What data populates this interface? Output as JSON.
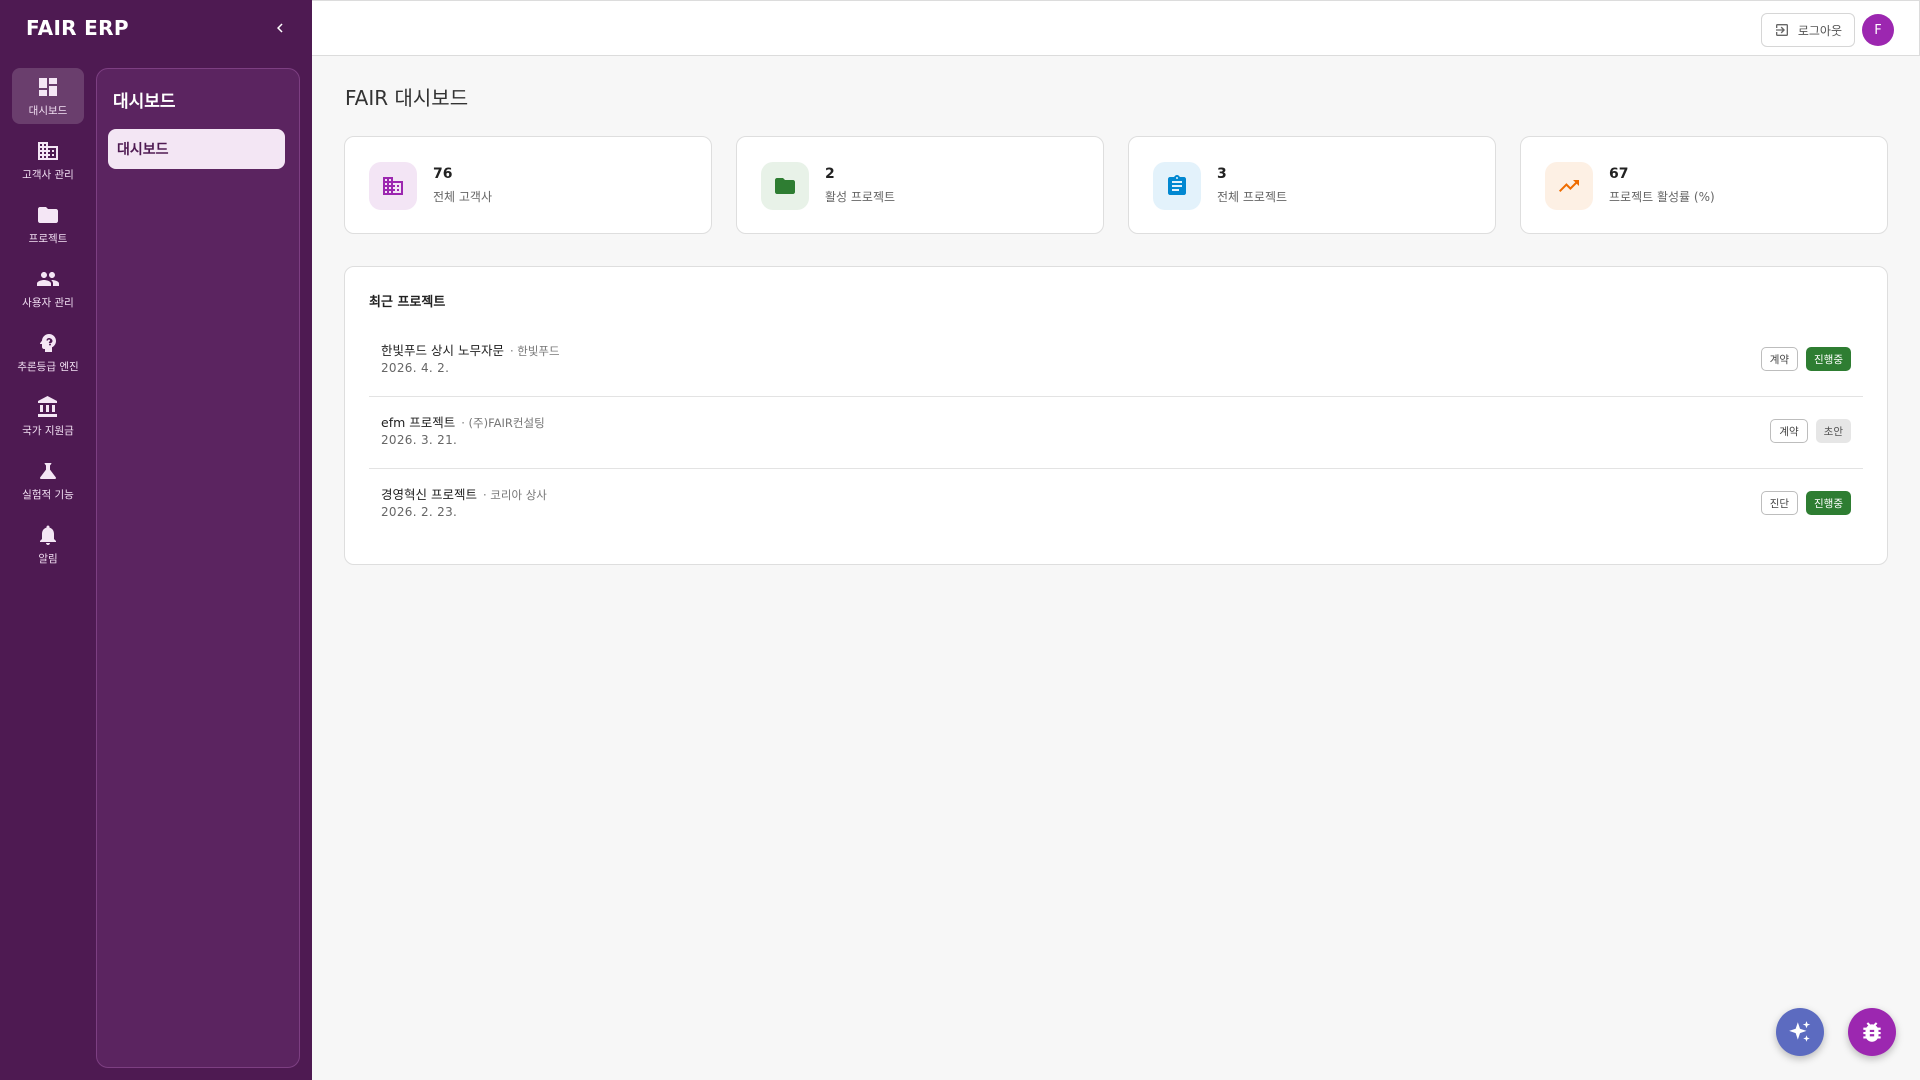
{
  "app": {
    "brand": "FAIR ERP"
  },
  "sidebar": {
    "items": [
      {
        "label": "대시보드",
        "icon": "dashboard-icon",
        "active": true
      },
      {
        "label": "고객사 관리",
        "icon": "building-icon"
      },
      {
        "label": "프로젝트",
        "icon": "folder-icon"
      },
      {
        "label": "사용자 관리",
        "icon": "people-icon"
      },
      {
        "label": "추론등급 엔진",
        "icon": "psychology-icon"
      },
      {
        "label": "국가 지원금",
        "icon": "bank-icon"
      },
      {
        "label": "실험적 기능",
        "icon": "flask-icon"
      },
      {
        "label": "알림",
        "icon": "bell-icon"
      }
    ],
    "subpanel": {
      "title": "대시보드",
      "items": [
        {
          "label": "대시보드"
        }
      ]
    }
  },
  "header": {
    "logout_label": "로그아웃",
    "avatar_initial": "F"
  },
  "main": {
    "title": "FAIR 대시보드",
    "stats": [
      {
        "value": "76",
        "label": "전체 고객사",
        "icon": "building-icon",
        "color": "#9c27b0",
        "bg": "#f3e5f5"
      },
      {
        "value": "2",
        "label": "활성 프로젝트",
        "icon": "folder-icon",
        "color": "#2e7d32",
        "bg": "#e8f2e8"
      },
      {
        "value": "3",
        "label": "전체 프로젝트",
        "icon": "clipboard-icon",
        "color": "#0288d1",
        "bg": "#e3f2fb"
      },
      {
        "value": "67",
        "label": "프로젝트 활성률 (%)",
        "icon": "trending-up-icon",
        "color": "#ef6c00",
        "bg": "#fdf0e4"
      }
    ],
    "recent": {
      "title": "최근 프로젝트",
      "projects": [
        {
          "name": "한빛푸드 상시 노무자문",
          "client": "· 한빛푸드",
          "date": "2026. 4. 2.",
          "type": "계약",
          "status": "진행중"
        },
        {
          "name": "efm 프로젝트",
          "client": "· (주)FAIR컨설팅",
          "date": "2026. 3. 21.",
          "type": "계약",
          "status": "초안"
        },
        {
          "name": "경영혁신 프로젝트",
          "client": "· 코리아 상사",
          "date": "2026. 2. 23.",
          "type": "진단",
          "status": "진행중"
        }
      ]
    }
  },
  "fabs": [
    {
      "icon": "sparkle-icon",
      "color": "#5c6bc0"
    },
    {
      "icon": "bug-icon",
      "color": "#9c27b0"
    }
  ]
}
